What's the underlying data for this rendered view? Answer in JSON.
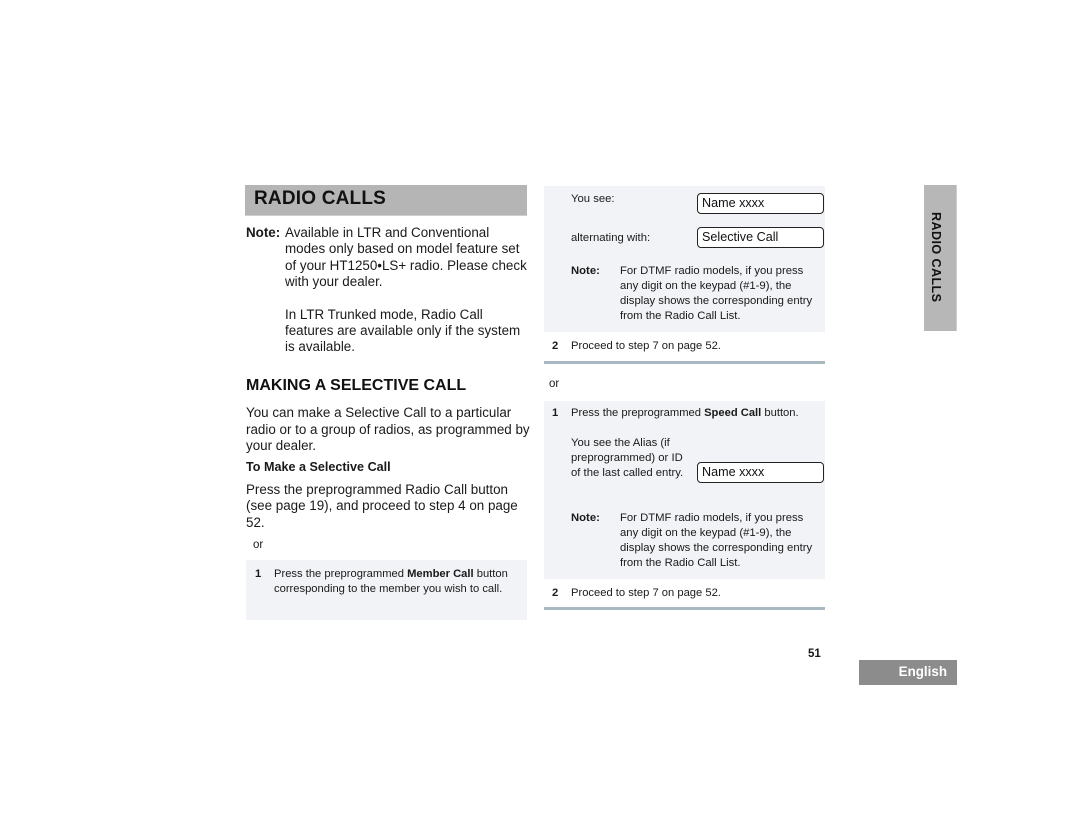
{
  "page": {
    "title": "RADIO CALLS",
    "side_tab": "RADIO CALLS",
    "page_number": "51",
    "language_badge": "English"
  },
  "left_column": {
    "note": {
      "label": "Note:",
      "text": "Available in LTR and Conventional modes only based on model feature set of your HT1250•LS+ radio. Please check with your dealer.",
      "paragraph2": "In LTR Trunked mode, Radio Call features are available only if the system is available."
    },
    "section_heading": "MAKING A SELECTIVE CALL",
    "intro": "You can make a Selective Call to a particular radio or to a group of radios, as programmed by your dealer.",
    "subheading": "To Make a Selective Call",
    "instruction": "Press the preprogrammed Radio Call button (see page 19), and proceed to step 4 on page 52.",
    "or": "or",
    "step1": {
      "number": "1",
      "text_before": "Press the preprogrammed ",
      "bold": "Member Call",
      "text_after": " button corresponding to the member you wish to call."
    }
  },
  "right_column": {
    "panel1": {
      "you_see_label": "You see:",
      "display1": "Name xxxx",
      "alternating_label": "alternating with:",
      "display2": "Selective Call",
      "note_label": "Note:",
      "note_text": "For DTMF radio models, if you press any digit on the keypad (#1-9), the display shows the corresponding entry from the Radio Call List."
    },
    "step2a": {
      "number": "2",
      "text": "Proceed to step 7 on page 52."
    },
    "or": "or",
    "panel2": {
      "step_number": "1",
      "text_before": "Press the preprogrammed ",
      "bold": "Speed Call",
      "text_after": " button.",
      "alias_text": "You see the Alias (if preprogrammed) or ID of the last called entry.",
      "display": "Name xxxx",
      "note_label": "Note:",
      "note_text": "For DTMF radio models, if you press any digit on the keypad (#1-9), the display shows the corresponding entry from the Radio Call List."
    },
    "step2b": {
      "number": "2",
      "text": "Proceed to step 7 on page 52."
    }
  },
  "colors": {
    "heading_bar": "#b5b5b5",
    "panel_bg": "#f1f3f6",
    "rule": "#a9b9c2",
    "language_badge": "#8c8c8c"
  }
}
